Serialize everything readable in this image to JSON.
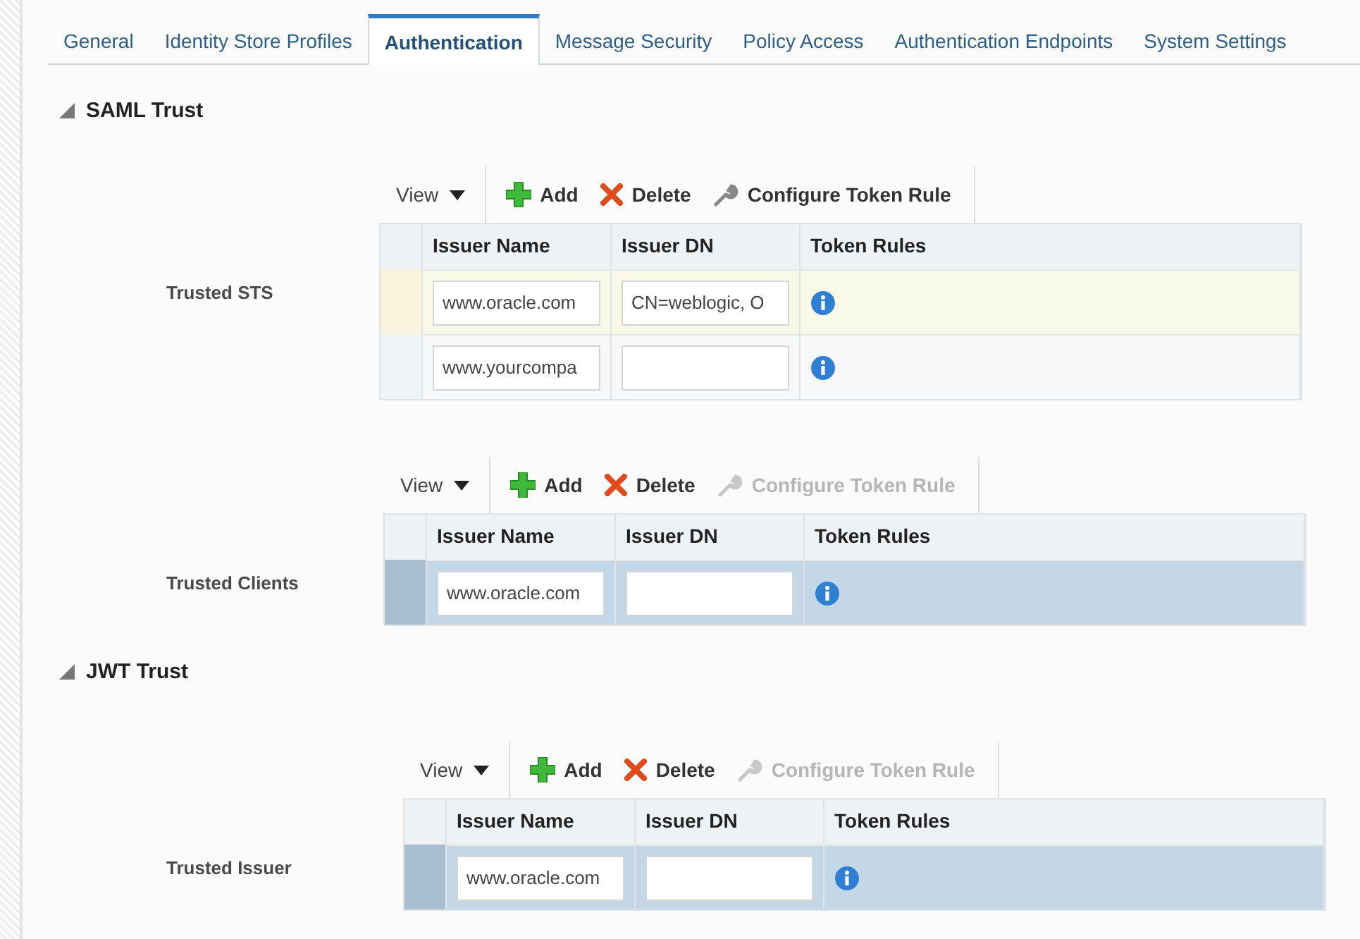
{
  "tabs": [
    {
      "label": "General",
      "selected": false
    },
    {
      "label": "Identity Store Profiles",
      "selected": false
    },
    {
      "label": "Authentication",
      "selected": true
    },
    {
      "label": "Message Security",
      "selected": false
    },
    {
      "label": "Policy Access",
      "selected": false
    },
    {
      "label": "Authentication Endpoints",
      "selected": false
    },
    {
      "label": "System Settings",
      "selected": false
    }
  ],
  "sections": [
    {
      "title": "SAML Trust",
      "expanded": true,
      "groups": [
        {
          "label": "Trusted STS",
          "toolbar": {
            "view": "View",
            "add": "Add",
            "delete": "Delete",
            "configure": "Configure Token Rule",
            "configure_disabled": false
          },
          "columns": [
            "Issuer Name",
            "Issuer DN",
            "Token Rules"
          ],
          "rows": [
            {
              "issuer_name": "www.oracle.com",
              "issuer_dn": "CN=weblogic, O",
              "selected": false,
              "current": true
            },
            {
              "issuer_name": "www.yourcompa",
              "issuer_dn": "",
              "selected": false,
              "current": false
            }
          ]
        },
        {
          "label": "Trusted Clients",
          "toolbar": {
            "view": "View",
            "add": "Add",
            "delete": "Delete",
            "configure": "Configure Token Rule",
            "configure_disabled": true
          },
          "columns": [
            "Issuer Name",
            "Issuer DN",
            "Token Rules"
          ],
          "rows": [
            {
              "issuer_name": "www.oracle.com",
              "issuer_dn": "",
              "selected": true,
              "current": false
            }
          ]
        }
      ]
    },
    {
      "title": "JWT Trust",
      "expanded": true,
      "groups": [
        {
          "label": "Trusted Issuer",
          "toolbar": {
            "view": "View",
            "add": "Add",
            "delete": "Delete",
            "configure": "Configure Token Rule",
            "configure_disabled": true
          },
          "columns": [
            "Issuer Name",
            "Issuer DN",
            "Token Rules"
          ],
          "rows": [
            {
              "issuer_name": "www.oracle.com",
              "issuer_dn": "",
              "selected": true,
              "current": false
            }
          ]
        }
      ]
    }
  ]
}
